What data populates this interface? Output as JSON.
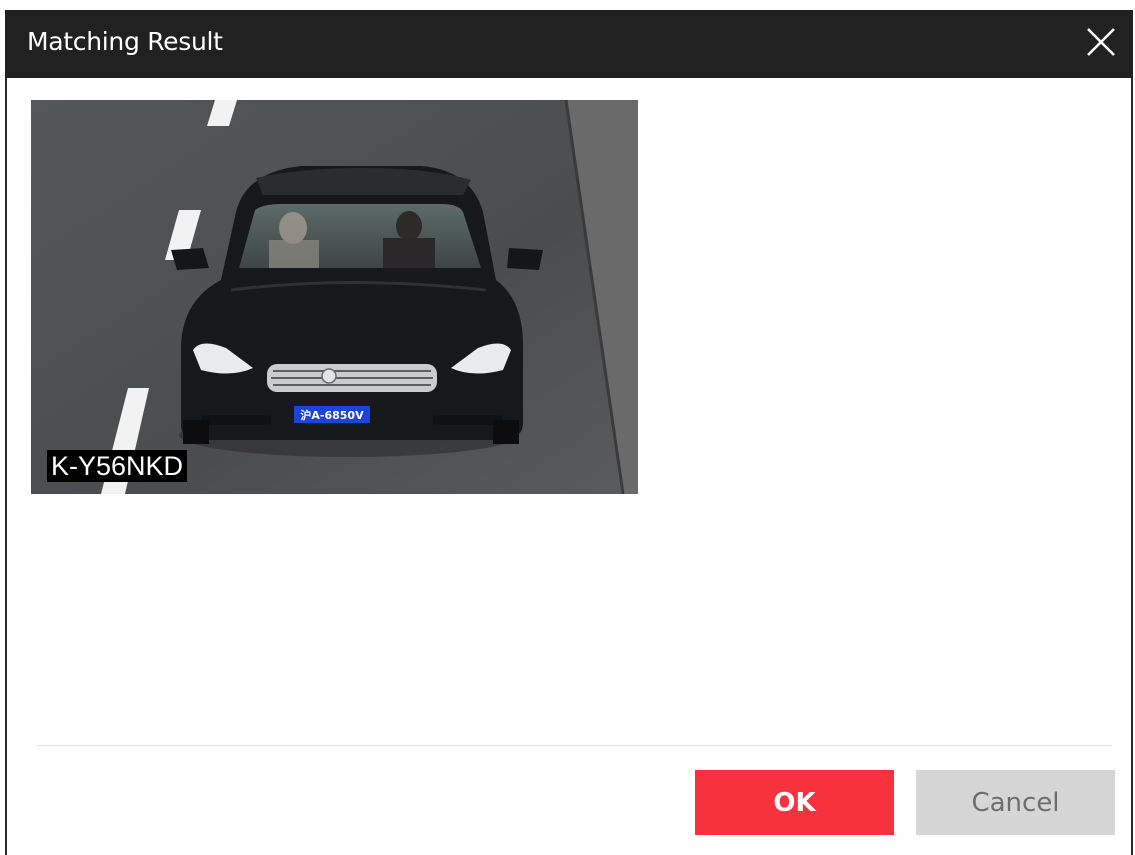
{
  "dialog": {
    "title": "Matching Result",
    "close_icon": "close-icon"
  },
  "result": {
    "plate_label": "K-Y56NKD",
    "image_plate_text": "沪A-6850V"
  },
  "buttons": {
    "ok_label": "OK",
    "cancel_label": "Cancel"
  },
  "colors": {
    "titlebar": "#212121",
    "ok": "#f7323f",
    "cancel": "#d6d6d6"
  }
}
